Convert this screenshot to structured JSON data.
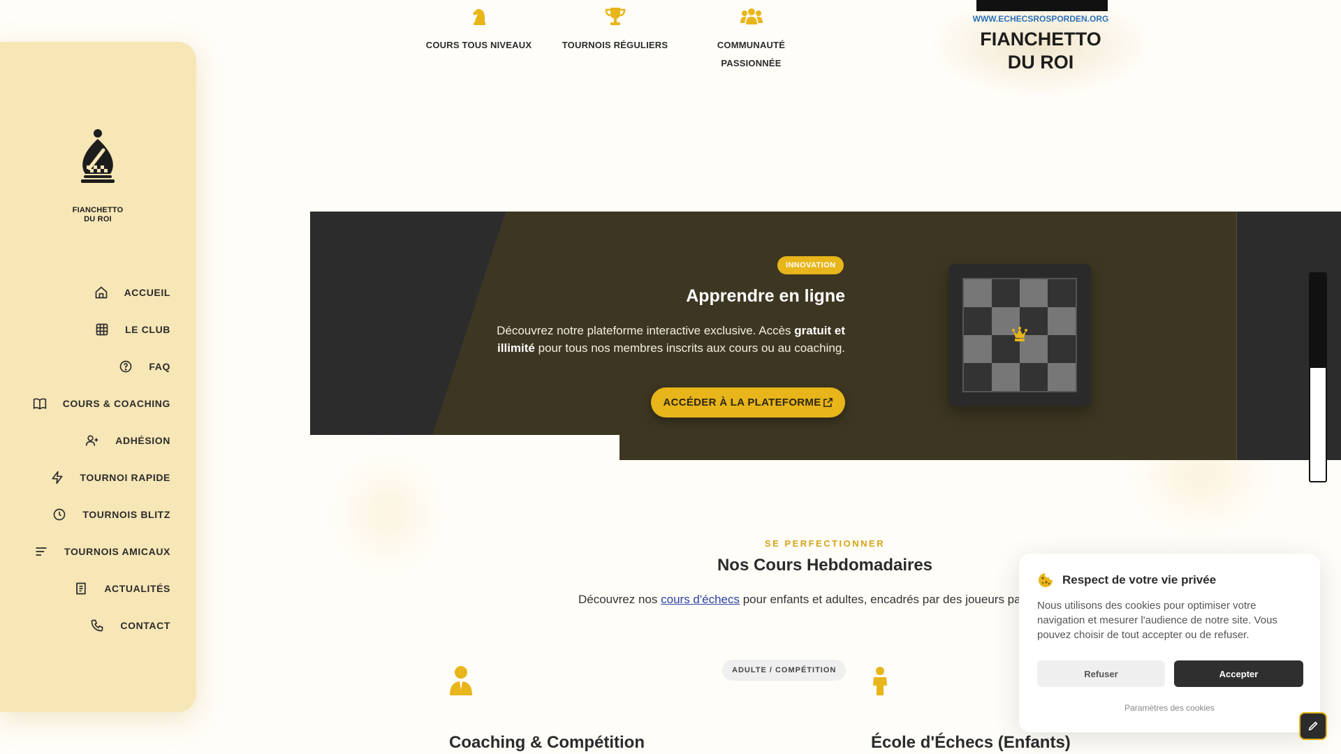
{
  "brand": {
    "logo_line1": "FIANCHETTO",
    "logo_line2": "DU ROI",
    "website": "WWW.ECHECSROSPORDEN.ORG",
    "accent": "#e8b51a",
    "sidebar_bg": "#f7e6b6",
    "dark": "#2c2c2c"
  },
  "nav": {
    "items": [
      {
        "label": "ACCUEIL",
        "icon": "home-icon"
      },
      {
        "label": "LE CLUB",
        "icon": "grid-icon"
      },
      {
        "label": "FAQ",
        "icon": "question-icon"
      },
      {
        "label": "COURS & COACHING",
        "icon": "book-icon"
      },
      {
        "label": "ADHÉSION",
        "icon": "user-plus-icon"
      },
      {
        "label": "TOURNOI RAPIDE",
        "icon": "bolt-icon"
      },
      {
        "label": "TOURNOIS BLITZ",
        "icon": "clock-icon"
      },
      {
        "label": "TOURNOIS AMICAUX",
        "icon": "lines-icon"
      },
      {
        "label": "ACTUALITÉS",
        "icon": "news-icon"
      },
      {
        "label": "CONTACT",
        "icon": "phone-icon"
      }
    ]
  },
  "features": [
    {
      "label": "COURS TOUS NIVEAUX",
      "icon": "knight-icon"
    },
    {
      "label": "TOURNOIS RÉGULIERS",
      "icon": "trophy-icon"
    },
    {
      "label": "COMMUNAUTÉ PASSIONNÉE",
      "icon": "users-icon"
    }
  ],
  "banner": {
    "badge": "INNOVATION",
    "title": "Apprendre en ligne",
    "text_part1": "Découvrez notre plateforme interactive exclusive. Accès ",
    "text_bold": "gratuit et illimité",
    "text_part2": " pour tous nos membres inscrits aux cours ou au coaching.",
    "cta_label": "ACCÉDER À LA PLATEFORME"
  },
  "courses": {
    "eyebrow": "SE PERFECTIONNER",
    "title": "Nos Cours Hebdomadaires",
    "desc_before": "Découvrez nos ",
    "desc_link": "cours d'échecs",
    "desc_after": " pour enfants et adultes, encadrés par des joueurs pa",
    "tag": "ADULTE / COMPÉTITION",
    "card1_title": "Coaching & Compétition",
    "card2_title": "École d'Échecs (Enfants)"
  },
  "cookie": {
    "title": "Respect de votre vie privée",
    "text": "Nous utilisons des cookies pour optimiser votre navigation et mesurer l'audience de notre site. Vous pouvez choisir de tout accepter ou de refuser.",
    "refuse_label": "Refuser",
    "accept_label": "Accepter",
    "settings_label": "Paramètres des cookies"
  }
}
